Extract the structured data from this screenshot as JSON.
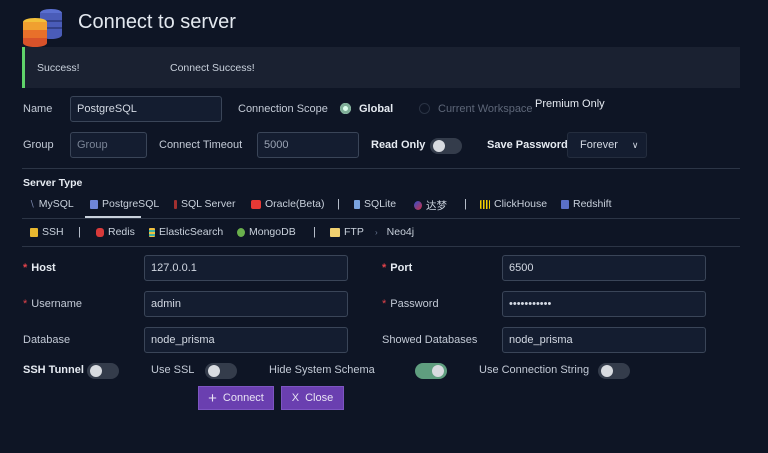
{
  "header": {
    "title": "Connect to server",
    "icon": "database-icon"
  },
  "alert": {
    "title": "Success!",
    "message": "Connect Success!",
    "color": "#5fd36a"
  },
  "form": {
    "name_label": "Name",
    "name_value": "PostgreSQL",
    "scope_label": "Connection Scope",
    "scope_global": "Global",
    "scope_workspace": "Current Workspace",
    "premium_tooltip": "Premium Only",
    "group_label": "Group",
    "group_placeholder": "Group",
    "timeout_label": "Connect Timeout",
    "timeout_value": "5000",
    "readonly_label": "Read Only",
    "readonly_on": false,
    "save_password_label": "Save Password",
    "save_password_value": "Forever",
    "server_type_label": "Server Type",
    "host_label": "Host",
    "host_value": "127.0.0.1",
    "port_label": "Port",
    "port_value": "6500",
    "username_label": "Username",
    "username_value": "admin",
    "password_label": "Password",
    "password_value": "•••••••••••",
    "database_label": "Database",
    "database_value": "node_prisma",
    "showed_db_label": "Showed Databases",
    "showed_db_value": "node_prisma",
    "ssh_tunnel_label": "SSH Tunnel",
    "ssh_tunnel_on": false,
    "use_ssl_label": "Use SSL",
    "use_ssl_on": false,
    "hide_schema_label": "Hide System Schema",
    "hide_schema_on": true,
    "conn_string_label": "Use Connection String",
    "conn_string_on": false
  },
  "server_types": {
    "row1": [
      "MySQL",
      "PostgreSQL",
      "SQL Server",
      "Oracle(Beta)",
      "SQLite",
      "达梦",
      "ClickHouse",
      "Redshift"
    ],
    "row2": [
      "SSH",
      "Redis",
      "ElasticSearch",
      "MongoDB",
      "FTP",
      "Neo4j"
    ],
    "selected": "PostgreSQL",
    "separator": "|"
  },
  "buttons": {
    "connect": "Connect",
    "close": "Close",
    "connect_icon": "+",
    "close_icon": "X"
  }
}
